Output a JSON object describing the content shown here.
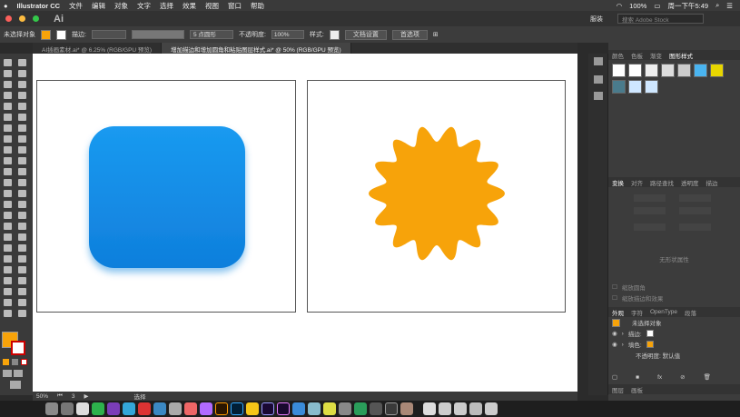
{
  "menubar": {
    "app_name": "Illustrator CC",
    "items": [
      "文件",
      "编辑",
      "对象",
      "文字",
      "选择",
      "效果",
      "视图",
      "窗口",
      "帮助"
    ],
    "battery": "100%",
    "clock": "周一下午5:49"
  },
  "appbar": {
    "logo": "Ai",
    "workspace": "服装",
    "search_placeholder": "搜索 Adobe Stock"
  },
  "control": {
    "selection_label": "未选择对象",
    "stroke_label": "描边:",
    "brush_label": "5 点圆形",
    "opacity_label": "不透明度:",
    "opacity_value": "100%",
    "style_label": "样式:",
    "doc_setup": "文档设置",
    "prefs": "首选项"
  },
  "tabs": [
    "AI插画素材.ai* @ 6.25% (RGB/GPU 预览)",
    "增加描边和增加圆角和粘贴图层样式.ai* @ 50% (RGB/GPU 预览)"
  ],
  "status": {
    "zoom": "50%",
    "page": "3",
    "mode": "选择"
  },
  "panels": {
    "top_tabs": [
      "颜色",
      "色板",
      "渐变",
      "图形样式"
    ],
    "transform_tabs": [
      "变换",
      "对齐",
      "路径查找",
      "透明度",
      "描边"
    ],
    "no_shape": "无形状属性",
    "check1": "缩放圆角",
    "check2": "缩放描边和效果",
    "appearance_tabs": [
      "外观",
      "字符",
      "OpenType",
      "段落"
    ],
    "appearance_title": "未选择对象",
    "stroke": "描边:",
    "fill": "填色:",
    "opacity": "不透明度: 默认值",
    "bottom_tabs": [
      "图层",
      "画板"
    ]
  },
  "colors": {
    "blue_top": "#1a9af0",
    "blue_bottom": "#0f7fdc",
    "orange": "#f7a30a",
    "fill_swatch": "#f7a30a"
  }
}
